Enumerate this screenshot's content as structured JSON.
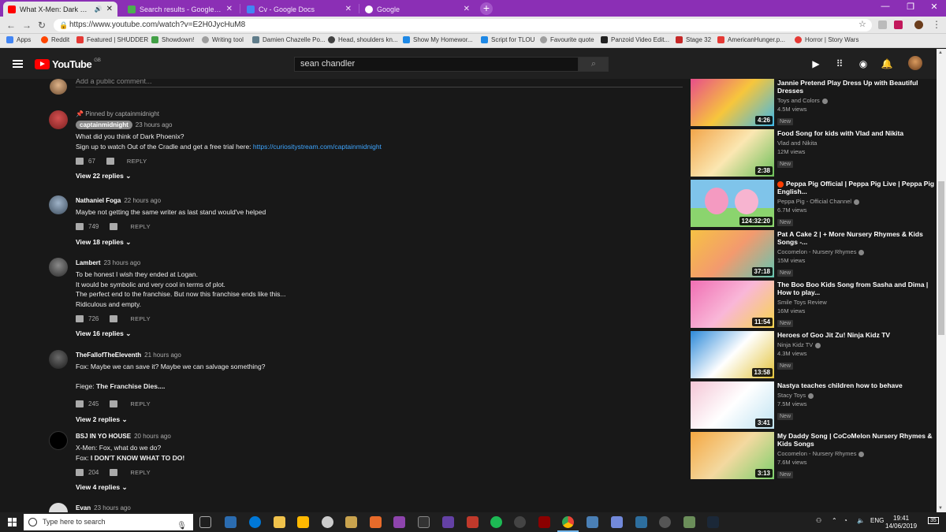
{
  "tabs": [
    {
      "title": "What X-Men: Dark Phoenix",
      "active": true,
      "color": "#ff0000"
    },
    {
      "title": "Search results - Google Drive",
      "active": false,
      "color": "#4caf50"
    },
    {
      "title": "Cv - Google Docs",
      "active": false,
      "color": "#4285f4"
    },
    {
      "title": "Google",
      "active": false,
      "color": "#ffffff"
    }
  ],
  "address": {
    "url": "https://www.youtube.com/watch?v=E2H0JycHuM8"
  },
  "bookmarks": [
    {
      "label": "Apps",
      "color": "#4285f4"
    },
    {
      "label": "Reddit",
      "color": "#ff4500"
    },
    {
      "label": "Featured | SHUDDER",
      "color": "#e53935"
    },
    {
      "label": "Showdown!",
      "color": "#43a047"
    },
    {
      "label": "Writing tool",
      "color": "#9e9e9e"
    },
    {
      "label": "Damien Chazelle Po...",
      "color": "#607d8b"
    },
    {
      "label": "Head, shoulders kn...",
      "color": "#424242"
    },
    {
      "label": "Show My Homewor...",
      "color": "#1e88e5"
    },
    {
      "label": "Script for TLOU",
      "color": "#1e88e5"
    },
    {
      "label": "Favourite quote",
      "color": "#9e9e9e"
    },
    {
      "label": "Panzoid Video Edit...",
      "color": "#222222"
    },
    {
      "label": "Stage 32",
      "color": "#c62828"
    },
    {
      "label": "AmericanHunger.p...",
      "color": "#e53935"
    },
    {
      "label": "Horror | Story Wars",
      "color": "#e53935"
    }
  ],
  "youtube": {
    "logo_text": "YouTube",
    "region": "GB",
    "search_query": "sean chandler"
  },
  "comments_section": {
    "add_comment_placeholder": "Add a public comment...",
    "comments": [
      {
        "pinned_label": "Pinned by captainmidnight",
        "author": "captainmidnight",
        "time": "23 hours ago",
        "lines": [
          "What did you think of Dark Phoenix?"
        ],
        "line_with_link": {
          "text": "Sign up to watch Out of the Cradle and get a free trial here: ",
          "link": "https://curiositystream.com/captainmidnight"
        },
        "likes": "67",
        "reply_label": "REPLY",
        "view_replies": "View 22 replies",
        "avatar_color": "#b33a3a"
      },
      {
        "author": "Nathaniel Foga",
        "time": "22 hours ago",
        "lines": [
          "Maybe not getting the same writer as last stand would've helped"
        ],
        "likes": "749",
        "reply_label": "REPLY",
        "view_replies": "View 18 replies",
        "avatar_color": "#7a8da3"
      },
      {
        "author": "Lambert",
        "time": "23 hours ago",
        "lines": [
          "To be honest I wish they ended at Logan.",
          "It would be symbolic and very cool in terms of plot.",
          "The perfect end to the franchise. But now this franchise ends like this...",
          "Ridiculous and empty."
        ],
        "likes": "726",
        "reply_label": "REPLY",
        "view_replies": "View 16 replies",
        "avatar_color": "#5a5a5a"
      },
      {
        "author": "TheFallofTheEleventh",
        "time": "21 hours ago",
        "lines": [
          "Fox: Maybe we can save it? Maybe we can salvage something?",
          ""
        ],
        "bold_line": {
          "prefix": "Fiege: ",
          "bold": "The Franchise Dies...."
        },
        "likes": "245",
        "reply_label": "REPLY",
        "view_replies": "View 2 replies",
        "avatar_color": "#3d3d3d"
      },
      {
        "author": "BSJ IN YO HOUSE",
        "time": "20 hours ago",
        "lines": [
          "X-Men: Fox, what do we do?"
        ],
        "bold_line": {
          "prefix": "Fox: ",
          "bold": "I DON'T KNOW WHAT TO DO!"
        },
        "likes": "204",
        "reply_label": "REPLY",
        "view_replies": "View 4 replies",
        "avatar_color": "#000000"
      },
      {
        "author": "Evan",
        "time": "23 hours ago",
        "avatar_color": "#cccccc"
      }
    ]
  },
  "sidebar": {
    "videos": [
      {
        "title": "Jannie Pretend Play Dress Up with Beautiful Dresses",
        "channel": "Toys and Colors",
        "views": "4.5M views",
        "badge": "New",
        "duration": "4:26",
        "verified": true,
        "live": false,
        "c1": "#e84e8a",
        "c2": "#3fb8e8"
      },
      {
        "title": "Food Song for kids with Vlad and Nikita",
        "channel": "Vlad and Nikita",
        "views": "12M views",
        "badge": "New",
        "duration": "2:38",
        "verified": false,
        "live": false,
        "c1": "#f2a54a",
        "c2": "#6bbf59"
      },
      {
        "title": "Peppa Pig Official | Peppa Pig Live | Peppa Pig English...",
        "channel": "Peppa Pig - Official Channel",
        "views": "6.7M views",
        "badge": "New",
        "duration": "124:32:20",
        "verified": true,
        "live": true,
        "c1": "#f49ac1",
        "c2": "#7fc4ea"
      },
      {
        "title": "Pat A Cake 2 | + More Nursery Rhymes & Kids Songs -...",
        "channel": "Cocomelon - Nursery Rhymes",
        "views": "15M views",
        "badge": "New",
        "duration": "37:18",
        "verified": true,
        "live": false,
        "c1": "#f6c244",
        "c2": "#64c5b1"
      },
      {
        "title": "The Boo Boo Kids Song from Sasha and Dima | How to play...",
        "channel": "Smile Toys Review",
        "views": "16M views",
        "badge": "New",
        "duration": "11:54",
        "verified": false,
        "live": false,
        "c1": "#f06fb3",
        "c2": "#f7d44c"
      },
      {
        "title": "Heroes of Goo Jit Zu! Ninja Kidz TV",
        "channel": "Ninja Kidz TV",
        "views": "4.3M views",
        "badge": "New",
        "duration": "13:58",
        "verified": true,
        "live": false,
        "c1": "#2d8ad9",
        "c2": "#e3c33a"
      },
      {
        "title": "Nastya teaches children how to behave",
        "channel": "Stacy Toys",
        "views": "7.5M views",
        "badge": "New",
        "duration": "3:41",
        "verified": true,
        "live": false,
        "c1": "#f4c6d6",
        "c2": "#bfe3f2"
      },
      {
        "title": "My Daddy Song | CoCoMelon Nursery Rhymes & Kids Songs",
        "channel": "Cocomelon - Nursery Rhymes",
        "views": "7.6M views",
        "badge": "New",
        "duration": "3:13",
        "verified": true,
        "live": false,
        "c1": "#f5a742",
        "c2": "#7ccf6b"
      }
    ]
  },
  "taskbar": {
    "search_placeholder": "Type here to search",
    "language": "ENG",
    "time": "19:41",
    "date": "14/06/2019",
    "notification_count": "35"
  }
}
